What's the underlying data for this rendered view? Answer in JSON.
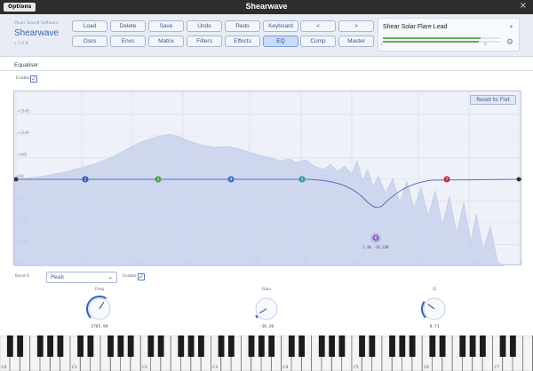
{
  "titlebar": {
    "options_label": "Options",
    "title": "Shearwave",
    "close_glyph": "×"
  },
  "brand": {
    "subtitle": "Music Sound Software",
    "name": "Shearwave",
    "version": "v 1.0.0"
  },
  "toolbar": {
    "row1": [
      "Load",
      "Delete",
      "Save",
      "Undo",
      "Redo",
      "Keyboard",
      "<",
      ">"
    ],
    "row2": [
      "Oscs",
      "Envs",
      "Matrix",
      "Filters",
      "Effects",
      "EQ",
      "Comp",
      "Master"
    ],
    "active": "EQ"
  },
  "preset": {
    "name": "Shear Solar Flare Lead",
    "scale_left": "L",
    "scale_right": "R",
    "star_icon": "star-icon",
    "tuner_icon": "tuner-icon"
  },
  "eq": {
    "section_title": "Equaliser",
    "enable_label": "Enable",
    "enabled": true,
    "reset_label": "Reset to Flat",
    "db_labels": [
      "+18dB",
      "+12dB",
      "+6dB",
      "0dB",
      "-6dB",
      "-12dB",
      "-18dB"
    ],
    "freq_labels": [
      "20",
      "50",
      "100",
      "200",
      "500",
      "1k",
      "2k",
      "5k",
      "10k",
      "20k"
    ],
    "bands": [
      {
        "id": "1",
        "color": "#333333"
      },
      {
        "id": "2",
        "color": "#3b5fb0"
      },
      {
        "id": "3",
        "color": "#4aa34a"
      },
      {
        "id": "4",
        "color": "#3b74c4"
      },
      {
        "id": "5",
        "color": "#3a9a9a"
      },
      {
        "id": "6",
        "color": "#8a68c0"
      },
      {
        "id": "7",
        "color": "#c0354a"
      },
      {
        "id": "8",
        "color": "#333333"
      }
    ],
    "selected_band": {
      "id": "6",
      "readout": "2.8k -16.2dB"
    }
  },
  "band_panel": {
    "band_label": "Band 6",
    "type": "Peak",
    "enable_label": "Enable",
    "enabled": true,
    "knobs": [
      {
        "label": "Freq",
        "value": "2765.90",
        "fraction": 0.62
      },
      {
        "label": "Gain",
        "value": "-16.20",
        "fraction": 0.05
      },
      {
        "label": "Q",
        "value": "0.71",
        "fraction": 0.3
      }
    ]
  },
  "keyboard": {
    "octave_labels": [
      "C0",
      "C1",
      "C2",
      "C3",
      "C4",
      "C5",
      "C6",
      "C7"
    ]
  },
  "colors": {
    "accent": "#3a66b0",
    "spectrum": "#c8d2ec",
    "curve": "#5b6fc4",
    "background": "#eef1f8"
  }
}
